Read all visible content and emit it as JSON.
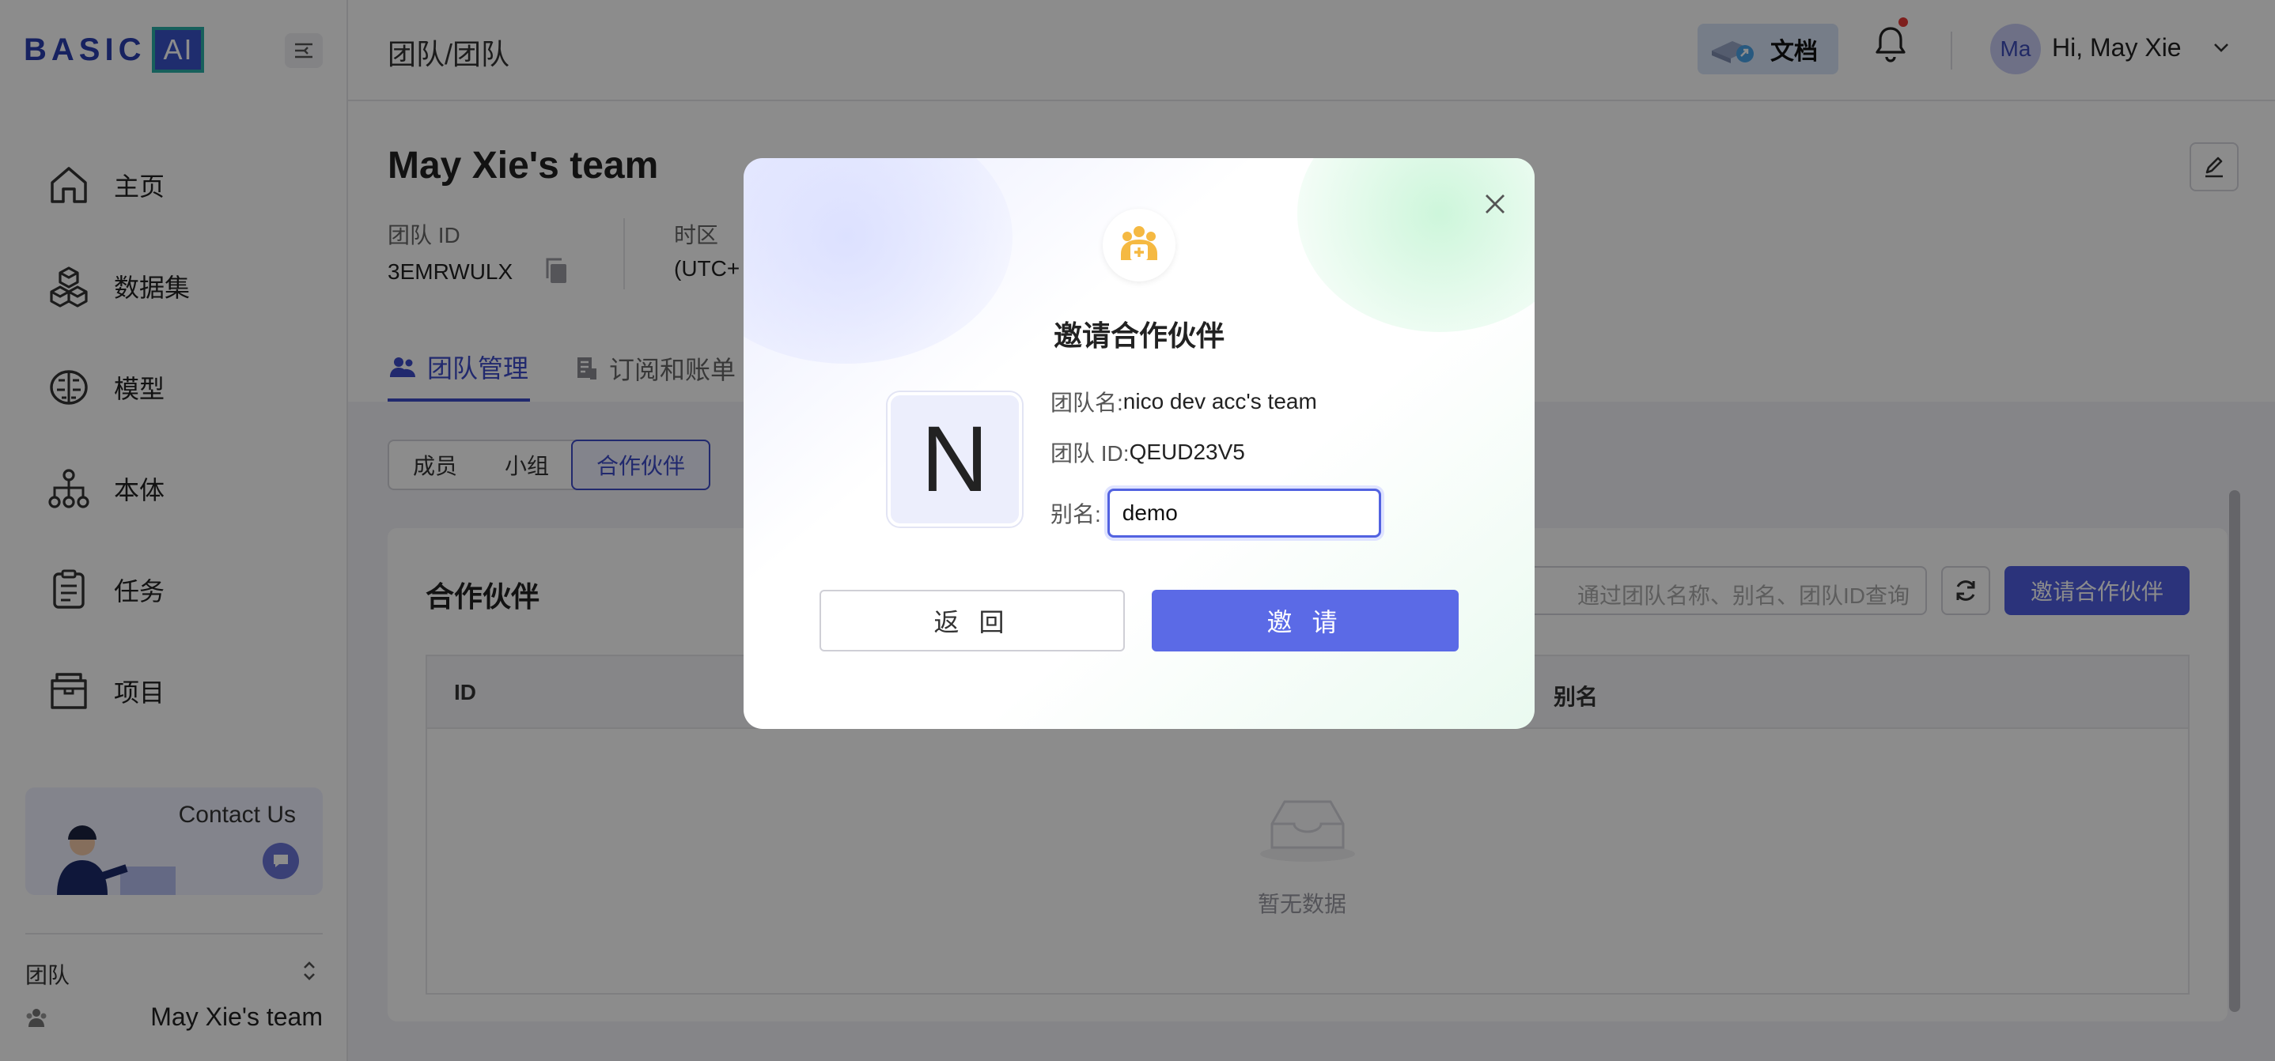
{
  "sidebar": {
    "logo_text": "BASIC",
    "logo_box": "AI",
    "items": [
      {
        "label": "主页",
        "icon": "home-icon"
      },
      {
        "label": "数据集",
        "icon": "dataset-icon"
      },
      {
        "label": "模型",
        "icon": "brain-icon"
      },
      {
        "label": "本体",
        "icon": "ontology-icon"
      },
      {
        "label": "任务",
        "icon": "task-icon"
      },
      {
        "label": "项目",
        "icon": "project-icon"
      }
    ],
    "contact": "Contact Us",
    "team_label": "团队",
    "team_name": "May Xie's team"
  },
  "topbar": {
    "breadcrumb": "团队/团队",
    "docs": "文档",
    "avatar_initials": "Ma",
    "greeting": "Hi, May Xie"
  },
  "team": {
    "title": "May Xie's team",
    "id_label": "团队 ID",
    "id_value": "3EMRWULX",
    "tz_label": "时区",
    "tz_value": "(UTC+"
  },
  "tabs": [
    {
      "label": "团队管理",
      "active": true
    },
    {
      "label": "订阅和账单",
      "active": false
    }
  ],
  "segments": [
    "成员",
    "小组",
    "合作伙伴"
  ],
  "partners": {
    "title": "合作伙伴",
    "search_placeholder": "通过团队名称、别名、团队ID查询",
    "invite_button": "邀请合作伙伴",
    "columns": [
      "ID",
      "别名"
    ],
    "empty": "暂无数据"
  },
  "modal": {
    "title": "邀请合作伙伴",
    "avatar_letter": "N",
    "team_name_label": "团队名:",
    "team_name_value": "nico dev acc's team",
    "team_id_label": "团队 ID:",
    "team_id_value": "QEUD23V5",
    "alias_label": "别名:",
    "alias_value": "demo",
    "back_button": "返 回",
    "invite_button": "邀 请"
  },
  "colors": {
    "primary": "#4f5ee0",
    "accent": "#3d4bc8"
  }
}
